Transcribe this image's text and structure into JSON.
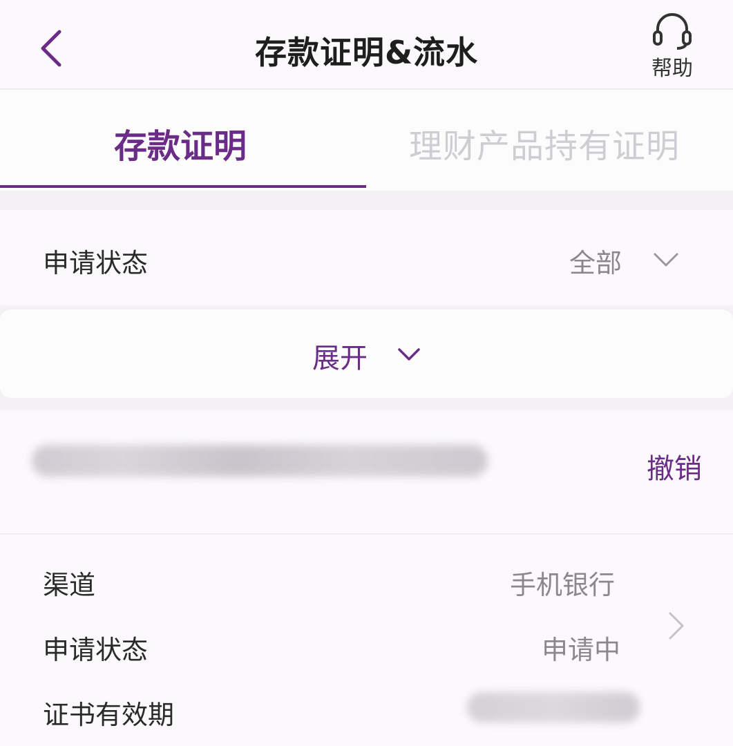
{
  "nav": {
    "title": "存款证明&流水",
    "help_label": "帮助"
  },
  "tabs": [
    {
      "label": "存款证明",
      "active": true
    },
    {
      "label": "理财产品持有证明",
      "active": false
    }
  ],
  "filter": {
    "label": "申请状态",
    "selected": "全部"
  },
  "expand_label": "展开",
  "record": {
    "action_label": "撤销",
    "details": [
      {
        "label": "渠道",
        "value": "手机银行"
      },
      {
        "label": "申请状态",
        "value": "申请中"
      },
      {
        "label": "证书有效期",
        "value": ""
      }
    ]
  },
  "colors": {
    "accent": "#6a2c86",
    "inactive_tab": "#cfcdd2",
    "value_text": "#8a888c"
  }
}
